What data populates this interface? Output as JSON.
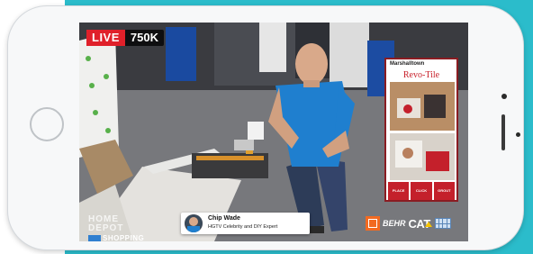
{
  "stream": {
    "live_label": "LIVE",
    "viewer_count": "750K"
  },
  "host": {
    "name": "Chip Wade",
    "title": "HGTV Celebrity and DIY Expert"
  },
  "show_logo": {
    "line1": "HOME DEPOT",
    "line2": "SHOPPING"
  },
  "ad": {
    "brand": "Marshalltown",
    "product": "Revo-Tile",
    "steps": [
      "PLACE",
      "CLICK",
      "GROUT"
    ]
  },
  "sponsors": {
    "behr": "BEHR",
    "cat": "CAT"
  },
  "colors": {
    "live_red": "#e0202a",
    "teal_background": "#2bbccb",
    "ad_accent": "#c8202a",
    "host_shirt": "#1f7fcf"
  },
  "icons": [
    "home-button-icon",
    "avatar-icon",
    "home-depot-logo-icon",
    "cat-logo-icon"
  ]
}
